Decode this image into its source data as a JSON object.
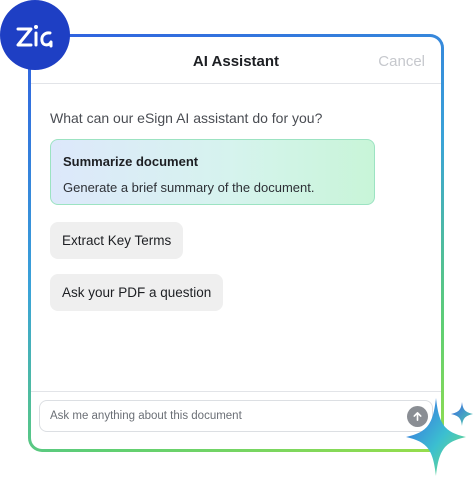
{
  "header": {
    "title": "AI Assistant",
    "cancel_label": "Cancel"
  },
  "prompt": "What can our eSign AI assistant do for you?",
  "summary_card": {
    "title": "Summarize document",
    "description": "Generate a brief summary of the document."
  },
  "chips": [
    {
      "label": "Extract Key Terms"
    },
    {
      "label": "Ask your PDF a question"
    }
  ],
  "input": {
    "placeholder": "Ask me anything about this document"
  },
  "icons": {
    "logo": "zia-logo-icon",
    "send": "arrow-up-icon",
    "sparkle": "sparkle-icon"
  },
  "colors": {
    "logo_bg": "#1e3fc4",
    "frame_start": "#2f5fe0",
    "frame_end": "#98de4a",
    "card_border": "#9ce3c2"
  }
}
